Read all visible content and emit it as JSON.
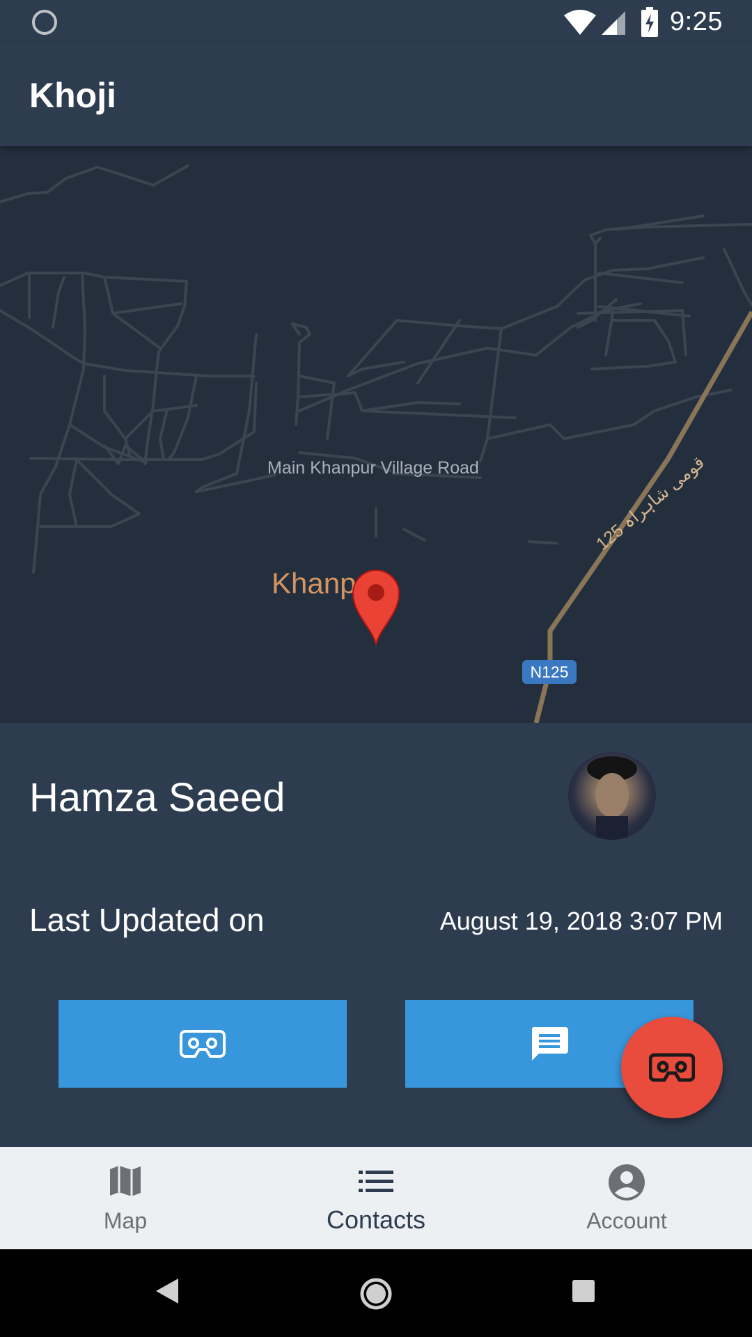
{
  "status_bar": {
    "time": "9:25"
  },
  "app_bar": {
    "title": "Khoji"
  },
  "map": {
    "road_label": "Main Khanpur Village Road",
    "highway_label": "125 قومی شاہراہ",
    "place_label": "Khanp",
    "shield_label": "N125"
  },
  "contact": {
    "name": "Hamza Saeed",
    "last_updated_label": "Last Updated on",
    "last_updated_value": "August 19, 2018 3:07 PM"
  },
  "bottom_nav": [
    {
      "label": "Map",
      "icon": "map-icon",
      "active": false
    },
    {
      "label": "Contacts",
      "icon": "list-icon",
      "active": true
    },
    {
      "label": "Account",
      "icon": "account-icon",
      "active": false
    }
  ],
  "colors": {
    "primary": "#2d3c4f",
    "accent_blue": "#3897dc",
    "fab_red": "#e94b3c",
    "map_bg": "#242f3e"
  }
}
